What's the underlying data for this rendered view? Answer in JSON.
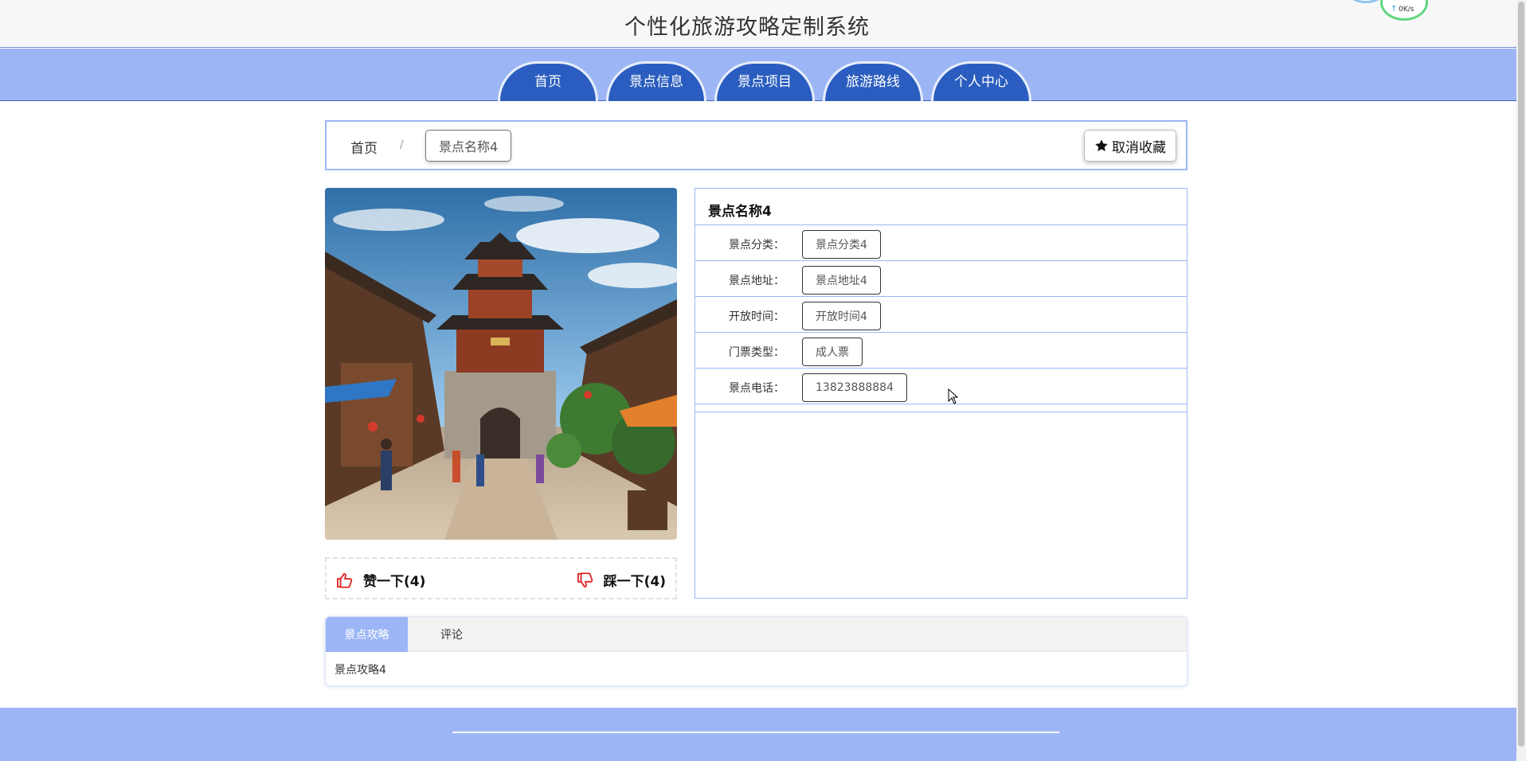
{
  "site": {
    "title": "个性化旅游攻略定制系统"
  },
  "net_widget": {
    "speed": "0K/s"
  },
  "nav": {
    "items": [
      {
        "label": "首页"
      },
      {
        "label": "景点信息"
      },
      {
        "label": "景点项目"
      },
      {
        "label": "旅游路线"
      },
      {
        "label": "个人中心"
      }
    ]
  },
  "breadcrumb": {
    "home": "首页",
    "separator": "/",
    "current": "景点名称4"
  },
  "favorite": {
    "label": "取消收藏",
    "icon": "star-icon"
  },
  "detail": {
    "name": "景点名称4",
    "fields": [
      {
        "label": "景点分类：",
        "value": "景点分类4"
      },
      {
        "label": "景点地址：",
        "value": "景点地址4"
      },
      {
        "label": "开放时间：",
        "value": "开放时间4"
      },
      {
        "label": "门票类型：",
        "value": "成人票"
      },
      {
        "label": "景点电话：",
        "value": "13823888884"
      }
    ]
  },
  "votes": {
    "up": {
      "label": "赞一下(4)",
      "icon": "thumbs-up-icon"
    },
    "down": {
      "label": "踩一下(4)",
      "icon": "thumbs-down-icon"
    }
  },
  "tabs": {
    "items": [
      {
        "label": "景点攻略",
        "active": true
      },
      {
        "label": "评论",
        "active": false
      }
    ],
    "content": "景点攻略4"
  },
  "colors": {
    "nav_band": "#9cb6f5",
    "nav_tab": "#2a5dbf",
    "vote_icon": "#e02424"
  }
}
